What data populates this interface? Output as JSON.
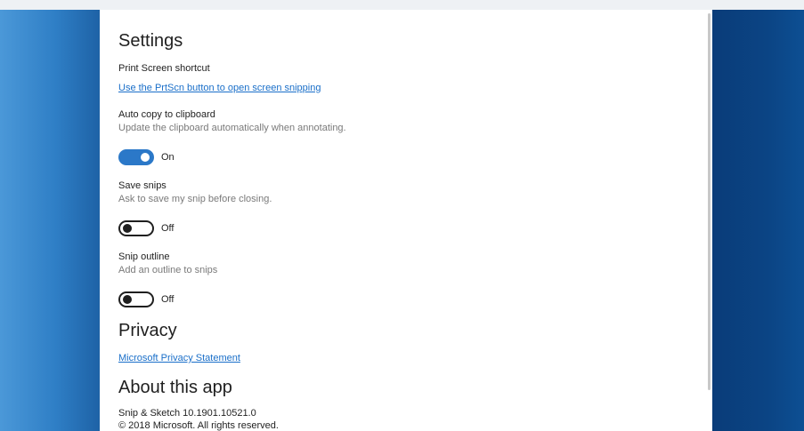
{
  "settings": {
    "title": "Settings",
    "print_screen": {
      "label": "Print Screen shortcut",
      "link": "Use the PrtScn button to open screen snipping"
    },
    "auto_copy": {
      "label": "Auto copy to clipboard",
      "description": "Update the clipboard automatically when annotating.",
      "state": "On"
    },
    "save_snips": {
      "label": "Save snips",
      "description": "Ask to save my snip before closing.",
      "state": "Off"
    },
    "snip_outline": {
      "label": "Snip outline",
      "description": "Add an outline to snips",
      "state": "Off"
    }
  },
  "privacy": {
    "title": "Privacy",
    "link": "Microsoft Privacy Statement"
  },
  "about": {
    "title": "About this app",
    "version": "Snip & Sketch 10.1901.10521.0",
    "copyright": "© 2018 Microsoft. All rights reserved."
  },
  "colors": {
    "accent": "#2b78c8",
    "link": "#1a6fc9",
    "wallpaper_left": "#2f7fc6",
    "wallpaper_right": "#0b4484"
  }
}
